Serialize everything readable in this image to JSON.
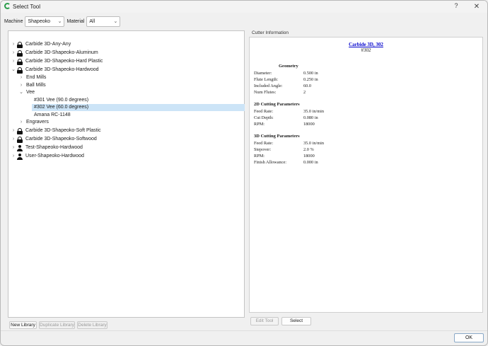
{
  "window": {
    "title": "Select Tool",
    "help_glyph": "?",
    "close_glyph": "✕"
  },
  "filters": {
    "machine_label": "Machine",
    "machine_value": "Shapeoko",
    "material_label": "Material",
    "material_value": "All"
  },
  "tree": {
    "libraries": [
      {
        "label": "Carbide 3D-Any-Any",
        "icon": "lock-icon",
        "expanded": false
      },
      {
        "label": "Carbide 3D-Shapeoko-Aluminum",
        "icon": "lock-icon",
        "expanded": false
      },
      {
        "label": "Carbide 3D-Shapeoko-Hard Plastic",
        "icon": "lock-icon",
        "expanded": false
      },
      {
        "label": "Carbide 3D-Shapeoko-Hardwood",
        "icon": "lock-icon",
        "expanded": true
      },
      {
        "label": "Carbide 3D-Shapeoko-Soft Plastic",
        "icon": "lock-icon",
        "expanded": false
      },
      {
        "label": "Carbide 3D-Shapeoko-Softwood",
        "icon": "lock-icon",
        "expanded": false
      },
      {
        "label": "Test-Shapeoko-Hardwood",
        "icon": "user-icon",
        "expanded": false
      },
      {
        "label": "User-Shapeoko-Hardwood",
        "icon": "user-icon",
        "expanded": false
      }
    ],
    "categories": [
      {
        "label": "End Mills",
        "expanded": false
      },
      {
        "label": "Ball Mills",
        "expanded": false
      },
      {
        "label": "Vee",
        "expanded": true
      },
      {
        "label": "Engravers",
        "expanded": false
      }
    ],
    "vee_tools": [
      {
        "label": "#301 Vee (90.0 degrees)",
        "selected": false
      },
      {
        "label": "#302 Vee (60.0 degrees)",
        "selected": true
      },
      {
        "label": "Amana RC-1148",
        "selected": false
      }
    ]
  },
  "library_buttons": {
    "new": "New Library",
    "duplicate": "Duplicate Library",
    "delete": "Delete Library"
  },
  "cutter_info": {
    "group_title": "Cutter Information",
    "tool_title": "Carbide 3D, 302",
    "tool_subtitle": "#302",
    "geometry": {
      "heading": "Geometry",
      "rows": [
        {
          "key": "Diameter:",
          "value": "0.500 in"
        },
        {
          "key": "Flute Length:",
          "value": "0.250 in"
        },
        {
          "key": "Included Angle:",
          "value": "60.0"
        },
        {
          "key": "Num Flutes:",
          "value": "2"
        }
      ]
    },
    "params_2d": {
      "heading": "2D Cutting Parameters",
      "rows": [
        {
          "key": "Feed Rate:",
          "value": "35.0 in/min"
        },
        {
          "key": "Cut Depth:",
          "value": "0.080 in"
        },
        {
          "key": "RPM:",
          "value": "18000"
        }
      ]
    },
    "params_3d": {
      "heading": "3D Cutting Parameters",
      "rows": [
        {
          "key": "Feed Rate:",
          "value": "35.0 in/min"
        },
        {
          "key": "Stepover:",
          "value": "2.0 %"
        },
        {
          "key": "RPM:",
          "value": "18000"
        },
        {
          "key": "Finish Allowance:",
          "value": "0.000 in"
        }
      ]
    }
  },
  "actions": {
    "edit_tool": "Edit Tool",
    "select": "Select",
    "ok": "OK"
  },
  "glyphs": {
    "chevron_right": "›",
    "chevron_down": "⌄",
    "combo_arrow": "⌄"
  },
  "colors": {
    "selection": "#cce4f7",
    "link": "#0000cc",
    "app_icon": "#2a9d4a"
  }
}
